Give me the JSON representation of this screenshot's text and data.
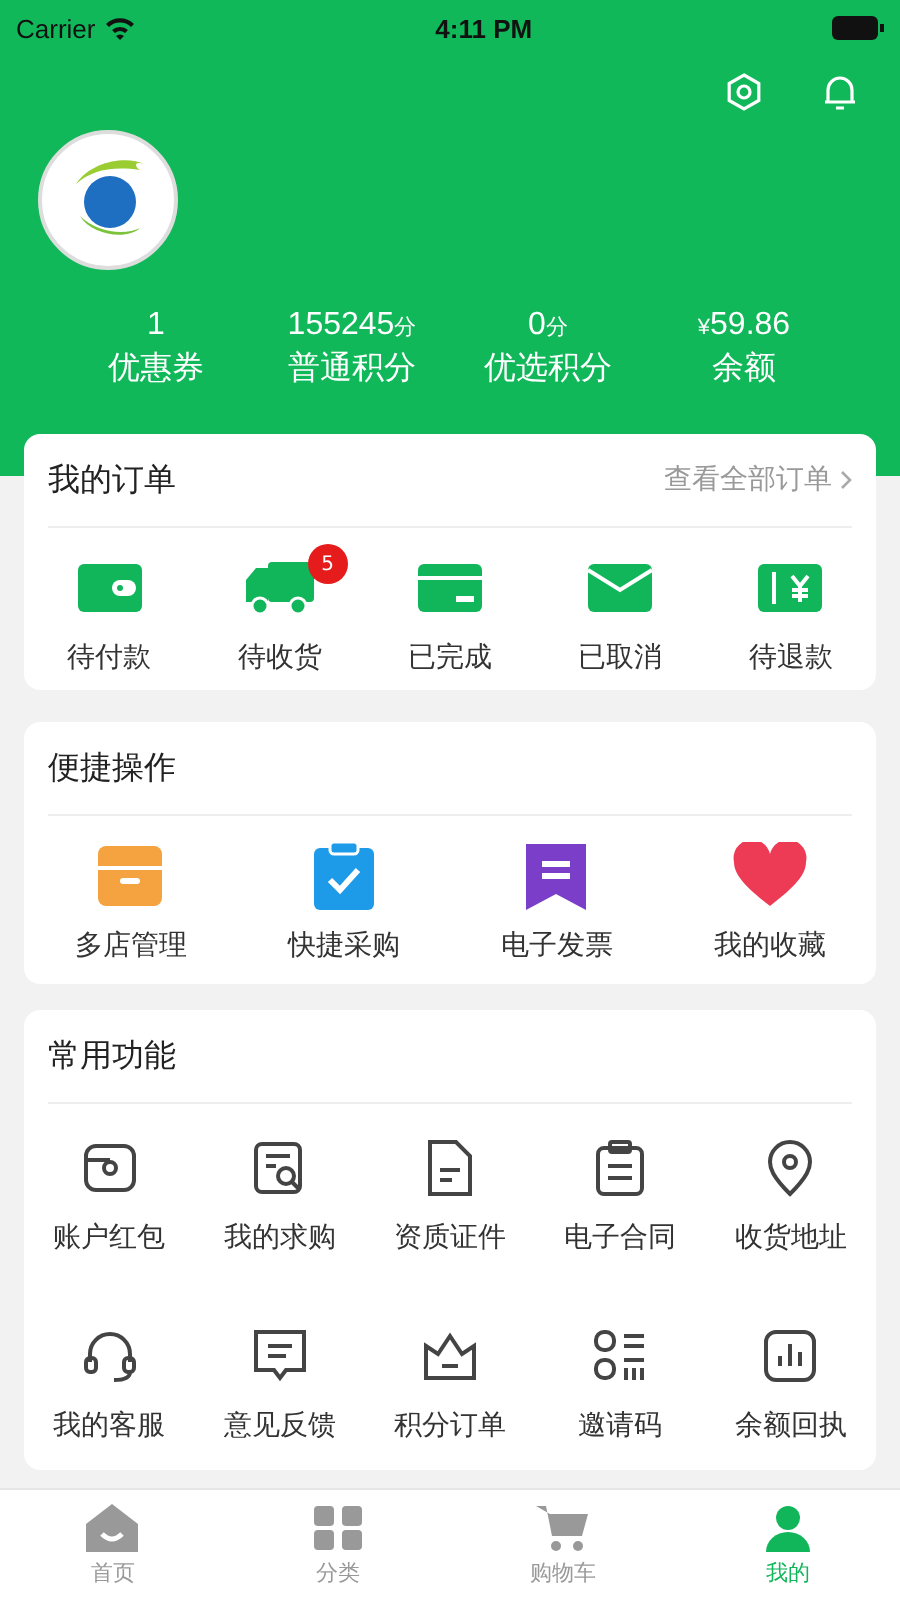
{
  "status_bar": {
    "carrier": "Carrier",
    "time": "4:11 PM"
  },
  "stats": [
    {
      "value": "1",
      "label": "优惠券"
    },
    {
      "value": "155245",
      "unit": "分",
      "label": "普通积分"
    },
    {
      "value": "0",
      "unit": "分",
      "label": "优选积分"
    },
    {
      "prefix": "¥",
      "value": "59.86",
      "label": "余额"
    }
  ],
  "orders": {
    "title": "我的订单",
    "link": "查看全部订单",
    "items": [
      {
        "kind": "wallet",
        "label": "待付款"
      },
      {
        "kind": "truck",
        "label": "待收货",
        "badge": "5"
      },
      {
        "kind": "card",
        "label": "已完成"
      },
      {
        "kind": "envelope",
        "label": "已取消"
      },
      {
        "kind": "ticket",
        "label": "待退款"
      }
    ]
  },
  "shortcuts": {
    "title": "便捷操作",
    "items": [
      {
        "kind": "store",
        "label": "多店管理"
      },
      {
        "kind": "clipboard",
        "label": "快捷采购"
      },
      {
        "kind": "invoice",
        "label": "电子发票"
      },
      {
        "kind": "heart",
        "label": "我的收藏"
      }
    ]
  },
  "functions": {
    "title": "常用功能",
    "items": [
      {
        "kind": "wallet",
        "label": "账户红包"
      },
      {
        "kind": "search",
        "label": "我的求购"
      },
      {
        "kind": "doc",
        "label": "资质证件"
      },
      {
        "kind": "clip",
        "label": "电子合同"
      },
      {
        "kind": "pin",
        "label": "收货地址"
      },
      {
        "kind": "headset",
        "label": "我的客服"
      },
      {
        "kind": "chat",
        "label": "意见反馈"
      },
      {
        "kind": "crown",
        "label": "积分订单"
      },
      {
        "kind": "qr",
        "label": "邀请码"
      },
      {
        "kind": "chart",
        "label": "余额回执"
      }
    ]
  },
  "tab_bar": [
    {
      "kind": "home",
      "label": "首页",
      "selected": false
    },
    {
      "kind": "grid",
      "label": "分类",
      "selected": false
    },
    {
      "kind": "cart",
      "label": "购物车",
      "selected": false
    },
    {
      "kind": "user",
      "label": "我的",
      "selected": true
    }
  ]
}
